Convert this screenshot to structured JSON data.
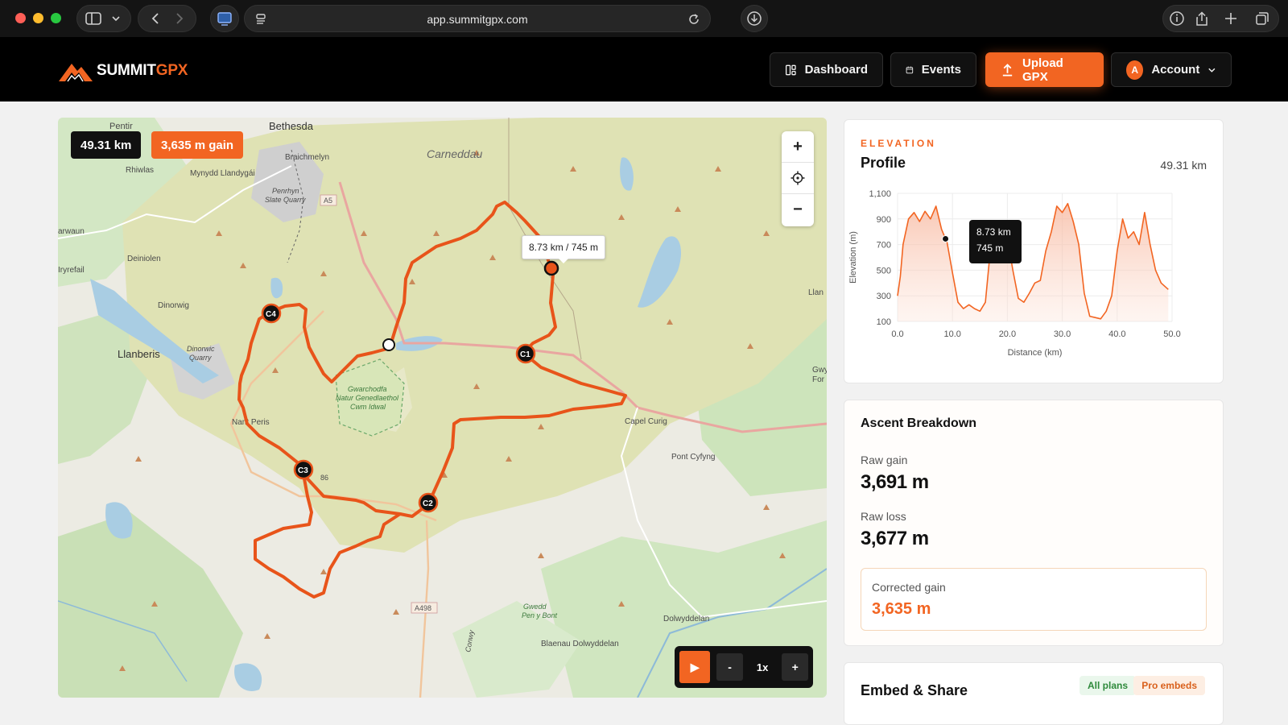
{
  "browser": {
    "url": "app.sumitgpx.com",
    "url_display": "app.summitgpx.com"
  },
  "brand": {
    "name_a": "SUMMIT",
    "name_b": "GPX",
    "accent": "#f26522"
  },
  "nav": {
    "dashboard": "Dashboard",
    "events": "Events",
    "upload": "Upload GPX",
    "account": "Account",
    "avatar_letter": "A"
  },
  "map": {
    "distance_badge": "49.31 km",
    "gain_badge": "3,635 m gain",
    "tooltip": "8.73 km / 745 m",
    "checkpoints": [
      "C1",
      "C2",
      "C3",
      "C4"
    ],
    "place_labels": {
      "bethesda": "Bethesda",
      "pentir": "Pentir",
      "carneddau": "Carneddau",
      "braichmelyn": "Braichmelyn",
      "rhiwlas": "Rhiwlas",
      "mynydd": "Mynydd Llandygái",
      "penrhyn1": "Penrhyn",
      "penrhyn2": "Slate Quarry",
      "a5": "A5",
      "arwaun": "arwaun",
      "deiniolen": "Deiniolen",
      "rynrefail": "Iryrefail",
      "dinorwig": "Dinorwig",
      "llanberis": "Llanberis",
      "dinorwic1": "Dinorwic",
      "dinorwic2": "Quarry",
      "gwarchodfa1": "Gwarchodfa",
      "gwarchodfa2": "Natur Genedlaethol",
      "gwarchodfa3": "Cwm Idwal",
      "nantperis": "Nant Peris",
      "capelcurig": "Capel Curig",
      "pontcyfyng": "Pont Cyfyng",
      "llan": "Llan",
      "gwy": "Gwy",
      "for": "For",
      "b6": "86",
      "a498": "A498",
      "conwy": "Conwy",
      "gwydir1": "Gwedd",
      "gwydir2": "Pen y Bont",
      "dolwyddelan": "Dolwyddelan",
      "blaenau": "Blaenau Dolwyddelan"
    },
    "playback": {
      "play": "▶",
      "minus": "-",
      "speed": "1x",
      "plus": "+"
    },
    "zoom": {
      "in": "+",
      "out": "−"
    }
  },
  "elevation": {
    "eyebrow": "ELEVATION",
    "title": "Profile",
    "distance": "49.31 km",
    "tooltip_dist": "8.73 km",
    "tooltip_elev": "745 m"
  },
  "chart_data": {
    "type": "area",
    "title": "",
    "xlabel": "Distance (km)",
    "ylabel": "Elevation (m)",
    "xlim": [
      0,
      50
    ],
    "ylim": [
      100,
      1100
    ],
    "x_ticks": [
      "0.0",
      "10.0",
      "20.0",
      "30.0",
      "40.0",
      "50.0"
    ],
    "y_ticks": [
      "100",
      "300",
      "500",
      "700",
      "900",
      "1,100"
    ],
    "grid": true,
    "series": [
      {
        "color": "#f26522",
        "x": [
          0,
          0.5,
          1,
          2,
          3,
          4,
          5,
          6,
          7,
          8,
          8.73,
          9,
          10,
          11,
          12,
          13,
          14,
          15,
          16,
          17,
          18,
          19,
          20,
          21,
          22,
          23,
          24,
          25,
          26,
          27,
          28,
          29,
          30,
          31,
          32,
          33,
          34,
          35,
          36,
          37,
          38,
          39,
          40,
          41,
          42,
          43,
          44,
          45,
          46,
          47,
          48,
          49.31
        ],
        "y": [
          300,
          450,
          700,
          900,
          950,
          880,
          960,
          900,
          1000,
          820,
          745,
          720,
          480,
          250,
          200,
          230,
          200,
          180,
          250,
          700,
          800,
          720,
          750,
          500,
          280,
          250,
          320,
          400,
          420,
          650,
          800,
          1000,
          950,
          1020,
          880,
          700,
          320,
          140,
          130,
          120,
          180,
          300,
          650,
          900,
          750,
          800,
          700,
          950,
          700,
          500,
          400,
          350
        ]
      }
    ]
  },
  "ascent": {
    "title": "Ascent Breakdown",
    "raw_gain_label": "Raw gain",
    "raw_gain": "3,691 m",
    "raw_loss_label": "Raw loss",
    "raw_loss": "3,677 m",
    "corrected_label": "Corrected gain",
    "corrected": "3,635 m"
  },
  "embed": {
    "title": "Embed & Share",
    "pill_all": "All plans",
    "pill_pro": "Pro embeds"
  }
}
